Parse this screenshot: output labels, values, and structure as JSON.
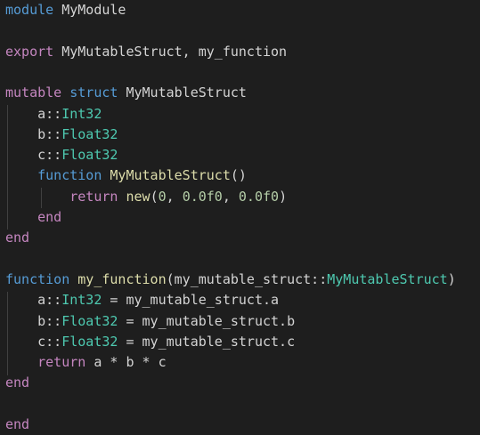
{
  "colors": {
    "background": "#1e1e1e",
    "keyword_purple": "#c586c0",
    "keyword_blue": "#569cd6",
    "type_teal": "#4ec9b0",
    "function_yellow": "#dcdcaa",
    "number_green": "#b5cea8",
    "text": "#d4d4d4"
  },
  "code": {
    "l1": {
      "kw": "module",
      "name": "MyModule"
    },
    "l3": {
      "kw": "export",
      "rest": "MyMutableStruct, my_function"
    },
    "l5": {
      "kw1": "mutable",
      "kw2": "struct",
      "name": "MyMutableStruct"
    },
    "l6": {
      "field": "a",
      "sep": "::",
      "type": "Int32"
    },
    "l7": {
      "field": "b",
      "sep": "::",
      "type": "Float32"
    },
    "l8": {
      "field": "c",
      "sep": "::",
      "type": "Float32"
    },
    "l9": {
      "kw": "function",
      "name": "MyMutableStruct",
      "paren": "()"
    },
    "l10": {
      "kw": "return",
      "fn": "new",
      "open": "(",
      "n1": "0",
      "c1": ", ",
      "n2": "0.0f0",
      "c2": ", ",
      "n3": "0.0f0",
      "close": ")"
    },
    "l11": {
      "kw": "end"
    },
    "l12": {
      "kw": "end"
    },
    "l14": {
      "kw": "function",
      "name": "my_function",
      "open": "(my_mutable_struct::",
      "type": "MyMutableStruct",
      "close": ")"
    },
    "l15": {
      "field": "a",
      "sep": "::",
      "type": "Int32",
      "rest": " = my_mutable_struct.a"
    },
    "l16": {
      "field": "b",
      "sep": "::",
      "type": "Float32",
      "rest": " = my_mutable_struct.b"
    },
    "l17": {
      "field": "c",
      "sep": "::",
      "type": "Float32",
      "rest": " = my_mutable_struct.c"
    },
    "l18": {
      "kw": "return",
      "rest": " a * b * c"
    },
    "l19": {
      "kw": "end"
    },
    "l21": {
      "kw": "end"
    }
  }
}
